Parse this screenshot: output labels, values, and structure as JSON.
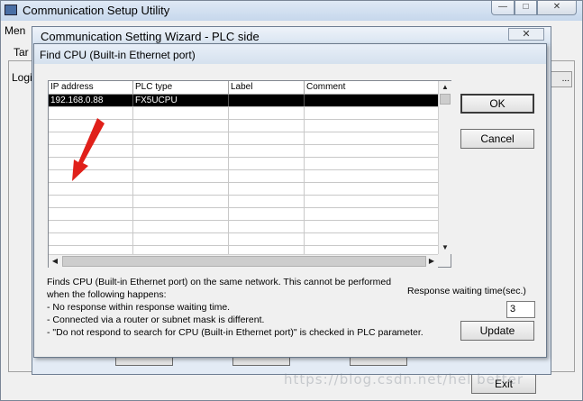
{
  "main_window": {
    "title": "Communication Setup Utility",
    "min_glyph": "—",
    "max_glyph": "□",
    "close_glyph": "✕",
    "menu_label": "Men",
    "tab_label": "Tar",
    "logi_label": "Logi",
    "ellipsis_label": "...",
    "exit_label": "Exit"
  },
  "wizard": {
    "title": "Communication Setting Wizard - PLC side",
    "close_glyph": "✕"
  },
  "find_cpu": {
    "title": "Find CPU (Built-in Ethernet port)",
    "columns": [
      "IP address",
      "PLC type",
      "Label",
      "Comment"
    ],
    "rows": [
      {
        "ip": "192.168.0.88",
        "plc_type": "FX5UCPU",
        "label": "",
        "comment": "",
        "selected": true
      }
    ],
    "empty_row_count": 12,
    "description": "Finds CPU (Built-in Ethernet port) on the same network. This cannot be performed\nwhen the following happens:\n- No response within response waiting time.\n- Connected via a router or subnet mask is different.\n- \"Do not respond to search for CPU (Built-in Ethernet port)\" is checked in PLC parameter.",
    "response_label": "Response waiting time(sec.)",
    "response_value": "3",
    "ok_label": "OK",
    "cancel_label": "Cancel",
    "update_label": "Update"
  },
  "watermark": "https://blog.csdn.net/hel better",
  "colors": {
    "annotation_arrow": "#e0201a",
    "selected_row_bg": "#000000",
    "selected_row_text": "#ffffff"
  }
}
